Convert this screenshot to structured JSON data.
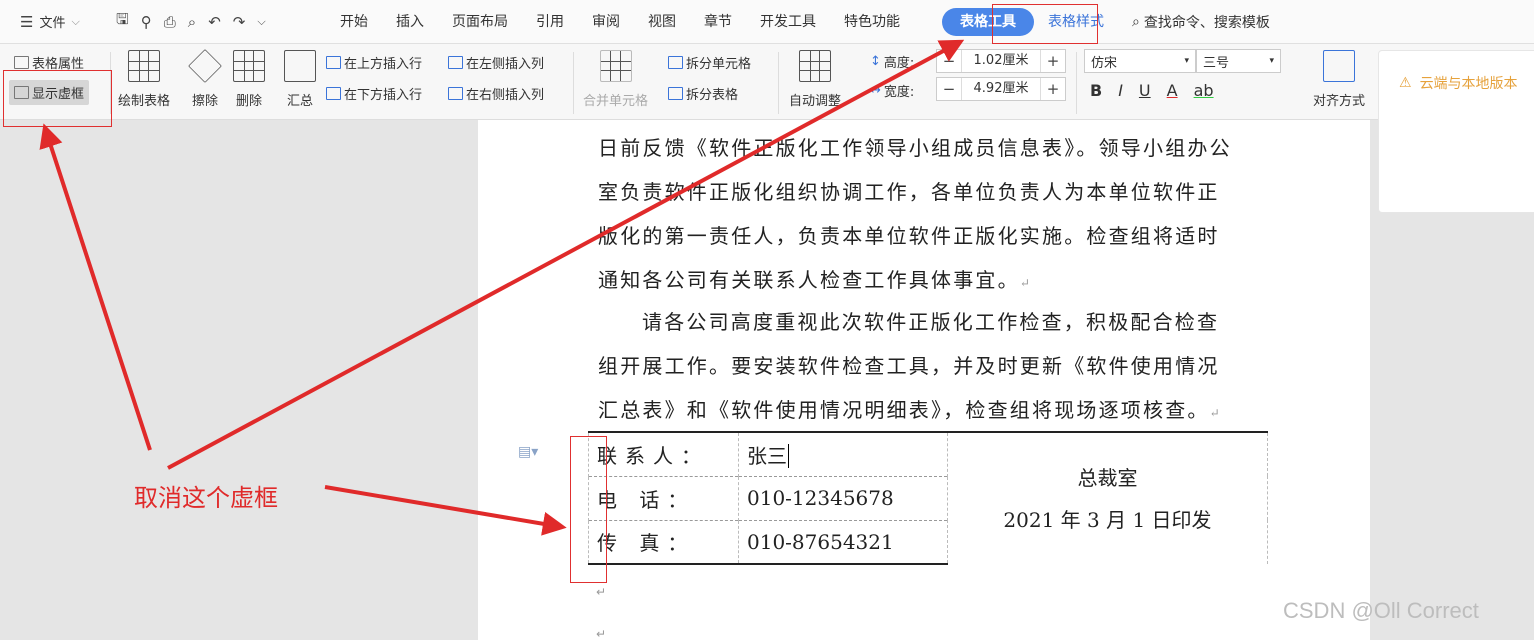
{
  "menubar": {
    "file_label": "文件",
    "tabs": [
      "开始",
      "插入",
      "页面布局",
      "引用",
      "审阅",
      "视图",
      "章节",
      "开发工具",
      "特色功能",
      "表格工具",
      "表格样式"
    ],
    "active_tab": "表格工具",
    "search_label": "查找命令、搜索模板"
  },
  "ribbon": {
    "table_props": "表格属性",
    "show_gridlines": "显示虚框",
    "draw_table": "绘制表格",
    "erase": "擦除",
    "delete": "删除",
    "summary": "汇总",
    "insert_above": "在上方插入行",
    "insert_below": "在下方插入行",
    "insert_left": "在左侧插入列",
    "insert_right": "在右侧插入列",
    "merge_cells": "合并单元格",
    "split_cells": "拆分单元格",
    "split_table": "拆分表格",
    "auto_fit": "自动调整",
    "height_label": "高度:",
    "height_value": "1.02厘米",
    "width_label": "宽度:",
    "width_value": "4.92厘米",
    "font_name": "仿宋",
    "font_size": "三号",
    "align": "对齐方式"
  },
  "notification": {
    "text": "云端与本地版本"
  },
  "document": {
    "para1_lines": [
      "日前反馈《软件正版化工作领导小组成员信息表》。领导小组办公",
      "室负责软件正版化组织协调工作，各单位负责人为本单位软件正",
      "版化的第一责任人，负责本单位软件正版化实施。检查组将适时",
      "通知各公司有关联系人检查工作具体事宜。"
    ],
    "para2_lines": [
      "请各公司高度重视此次软件正版化工作检查，积极配合检查",
      "组开展工作。要安装软件检查工具，并及时更新《软件使用情况",
      "汇总表》和《软件使用情况明细表》，检查组将现场逐项核查。"
    ],
    "table": {
      "rows": [
        {
          "label": "联系人：",
          "value": "张三"
        },
        {
          "label": "电  话：",
          "value": "010-12345678"
        },
        {
          "label": "传  真：",
          "value": "010-87654321"
        }
      ],
      "right_line1": "总裁室",
      "right_line2": "2021 年 3 月 1 日印发"
    }
  },
  "annotation": {
    "callout_text": "取消这个虚框",
    "color": "#e02a2a"
  },
  "watermark": "CSDN @Oll Correct"
}
